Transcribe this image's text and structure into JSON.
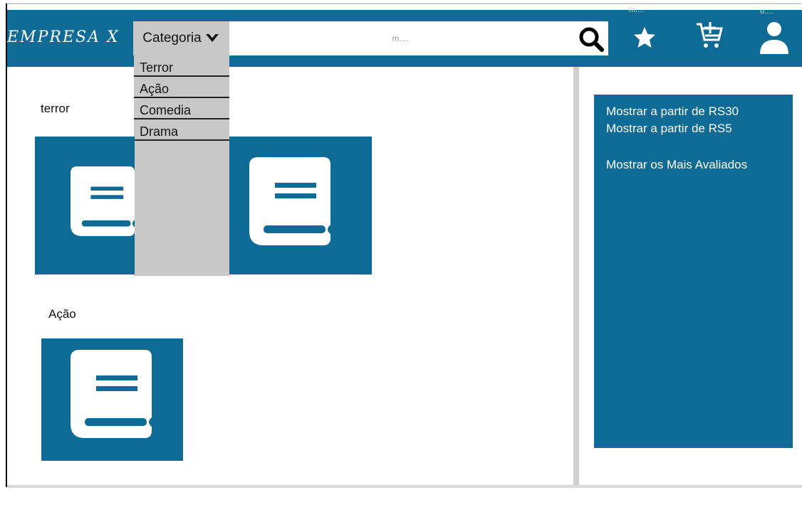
{
  "header": {
    "logo": "EMPRESA X",
    "category_label": "Categoria",
    "search_placeholder": "m....",
    "favorites_caption": "m....",
    "user_caption": "u...."
  },
  "category_menu": {
    "items": [
      "Terror",
      "Ação",
      "Comedia",
      "Drama"
    ]
  },
  "sections": [
    {
      "label": "terror"
    },
    {
      "label": "Ação"
    }
  ],
  "filters": {
    "items": [
      "Mostrar a partir de RS30",
      "Mostrar a partir de RS5",
      "Mostrar os Mais Avaliados"
    ]
  },
  "icons": {
    "dropdown": "chevron-down-icon",
    "search": "search-icon",
    "favorites": "star-icon",
    "cart": "cart-add-icon",
    "user": "user-icon",
    "product": "book-icon"
  },
  "colors": {
    "brand": "#0e6b96",
    "dropdown_bg": "#c8c8c8",
    "divider": "#cfcfcf"
  }
}
